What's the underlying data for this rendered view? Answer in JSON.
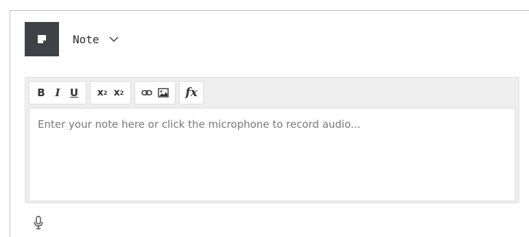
{
  "header": {
    "note_type_label": "Note",
    "icons": {
      "note": "sticky-note-icon",
      "dropdown": "chevron-down-icon"
    }
  },
  "toolbar": {
    "bold": "B",
    "italic": "I",
    "underline": "U",
    "superscript_base": "x",
    "superscript_exp": "2",
    "subscript_base": "x",
    "subscript_exp": "2",
    "link_icon": "link-icon",
    "image_icon": "image-icon",
    "formula": "fx"
  },
  "editor": {
    "placeholder": "Enter your note here or click the microphone to record audio..."
  },
  "microphone": {
    "icon": "microphone-icon"
  },
  "colors": {
    "tile_bg": "#3e4145",
    "editor_bg": "#eeeeee",
    "placeholder_text": "#777777"
  }
}
